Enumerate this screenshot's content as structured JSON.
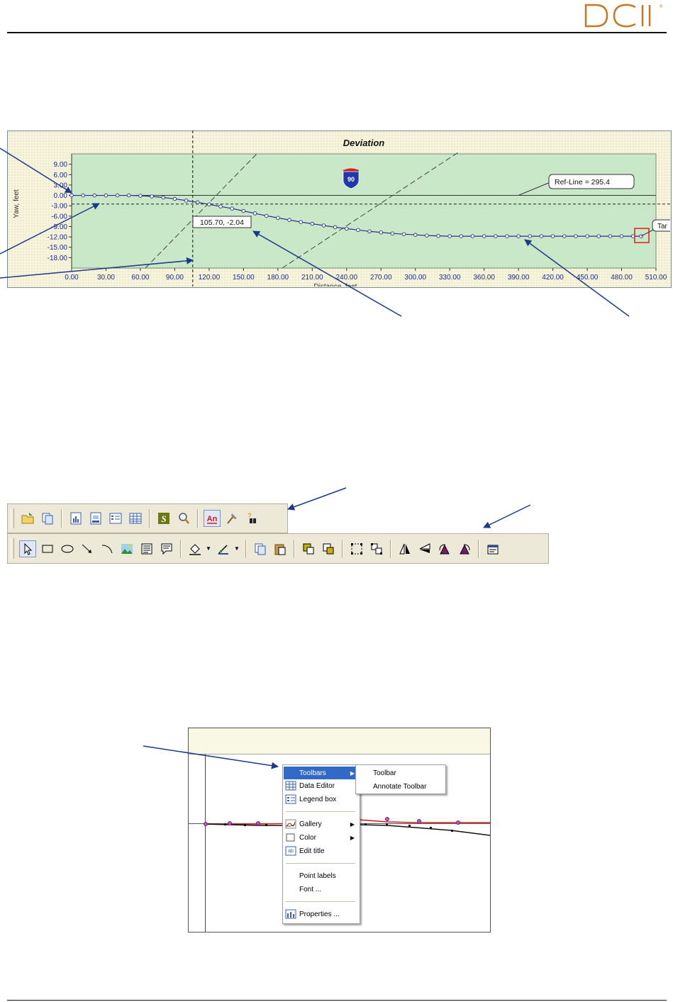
{
  "header": {
    "logo_text": "DCI",
    "logo_color": "#c8781e"
  },
  "chart_data": {
    "type": "line",
    "title": "Deviation",
    "xlabel": "Distance, feet",
    "ylabel": "Yaw, feet",
    "xlim": [
      0,
      510
    ],
    "ylim": [
      -21,
      12
    ],
    "x_ticks": [
      "0.00",
      "30.00",
      "60.00",
      "90.00",
      "120.00",
      "150.00",
      "180.00",
      "210.00",
      "240.00",
      "270.00",
      "300.00",
      "330.00",
      "360.00",
      "390.00",
      "420.00",
      "450.00",
      "480.00",
      "510.00"
    ],
    "y_ticks": [
      "9.00",
      "6.00",
      "3.00",
      "0.00",
      "-3.00",
      "-6.00",
      "-9.00",
      "-12.00",
      "-15.00",
      "-18.00"
    ],
    "series": [
      {
        "x": [
          0,
          10,
          20,
          30,
          40,
          50,
          60,
          70,
          80,
          90,
          100,
          110,
          120,
          130,
          140,
          150,
          160,
          170,
          180,
          190,
          200,
          210,
          220,
          230,
          240,
          250,
          260,
          270,
          280,
          290,
          300,
          310,
          320,
          330,
          340,
          350,
          360,
          370,
          380,
          390,
          400,
          410,
          420,
          430,
          440,
          450,
          460,
          470,
          480,
          490,
          497
        ],
        "y": [
          0,
          0,
          0,
          0,
          0,
          0,
          -0.1,
          -0.3,
          -0.6,
          -1.0,
          -1.5,
          -2.0,
          -2.6,
          -3.2,
          -3.8,
          -4.5,
          -5.2,
          -5.9,
          -6.5,
          -7.1,
          -7.7,
          -8.2,
          -8.7,
          -9.2,
          -9.6,
          -10.0,
          -10.4,
          -10.7,
          -11.0,
          -11.2,
          -11.4,
          -11.6,
          -11.7,
          -11.8,
          -11.8,
          -11.8,
          -11.8,
          -11.8,
          -11.8,
          -11.8,
          -11.8,
          -11.8,
          -11.8,
          -11.8,
          -11.8,
          -11.8,
          -11.8,
          -11.8,
          -11.8,
          -11.8,
          -11.8
        ]
      }
    ],
    "reference_line_y": -2.5,
    "cursor_x": 105.7,
    "cursor_label": "105.70, -2.04",
    "ref_line_label": "Ref-Line = 295.4",
    "target_label": "Tar",
    "sign_label": "90",
    "colors": {
      "plot_bg": "#c8e8c8",
      "series": "#2a2f8f",
      "target_box": "#e02020"
    }
  },
  "toolbar1": {
    "buttons": [
      "open-folder",
      "copy",
      "chart-1",
      "chart-2",
      "legend",
      "data-grid",
      "s-tool",
      "zoom",
      "annotate",
      "pick",
      "help-find"
    ]
  },
  "toolbar2": {
    "buttons": [
      "select-arrow",
      "rectangle",
      "ellipse",
      "line-arrow",
      "arc",
      "picture",
      "text-box",
      "callout",
      "fill-color",
      "line-color",
      "copy",
      "paste",
      "bring-front",
      "send-back",
      "group",
      "ungroup",
      "flip-h",
      "flip-v",
      "rotate",
      "rotate-2",
      "properties"
    ]
  },
  "context_menu": {
    "items": [
      {
        "label": "Toolbars",
        "icon": "none",
        "submenu": true
      },
      {
        "label": "Data Editor",
        "icon": "grid-icon"
      },
      {
        "label": "Legend box",
        "icon": "legend-icon"
      },
      {
        "label": "Gallery",
        "icon": "chart-icon",
        "submenu": true
      },
      {
        "label": "Color",
        "icon": "color-swatch-icon",
        "submenu": true
      },
      {
        "label": "Edit title",
        "icon": "title-icon"
      },
      {
        "label": "Point labels",
        "icon": "none"
      },
      {
        "label": "Font ...",
        "icon": "none"
      },
      {
        "label": "Properties ...",
        "icon": "properties-icon"
      }
    ],
    "submenu": [
      "Toolbar",
      "Annotate Toolbar"
    ]
  }
}
